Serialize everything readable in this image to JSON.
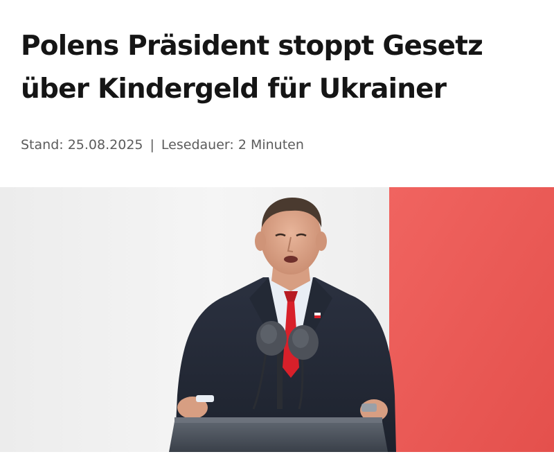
{
  "article": {
    "headline_line1": "Polens Präsident stoppt Gesetz",
    "headline_line2": "über Kindergeld für Ukrainer",
    "meta": {
      "stand_label": "Stand:",
      "date": "25.08.2025",
      "separator": "|",
      "reading_label": "Lesedauer:",
      "reading_time": "2 Minuten"
    }
  },
  "colors": {
    "headline": "#151515",
    "meta": "#5b5b5b",
    "flag_red": "#ea5754",
    "backdrop_white": "#f2f2f2"
  }
}
